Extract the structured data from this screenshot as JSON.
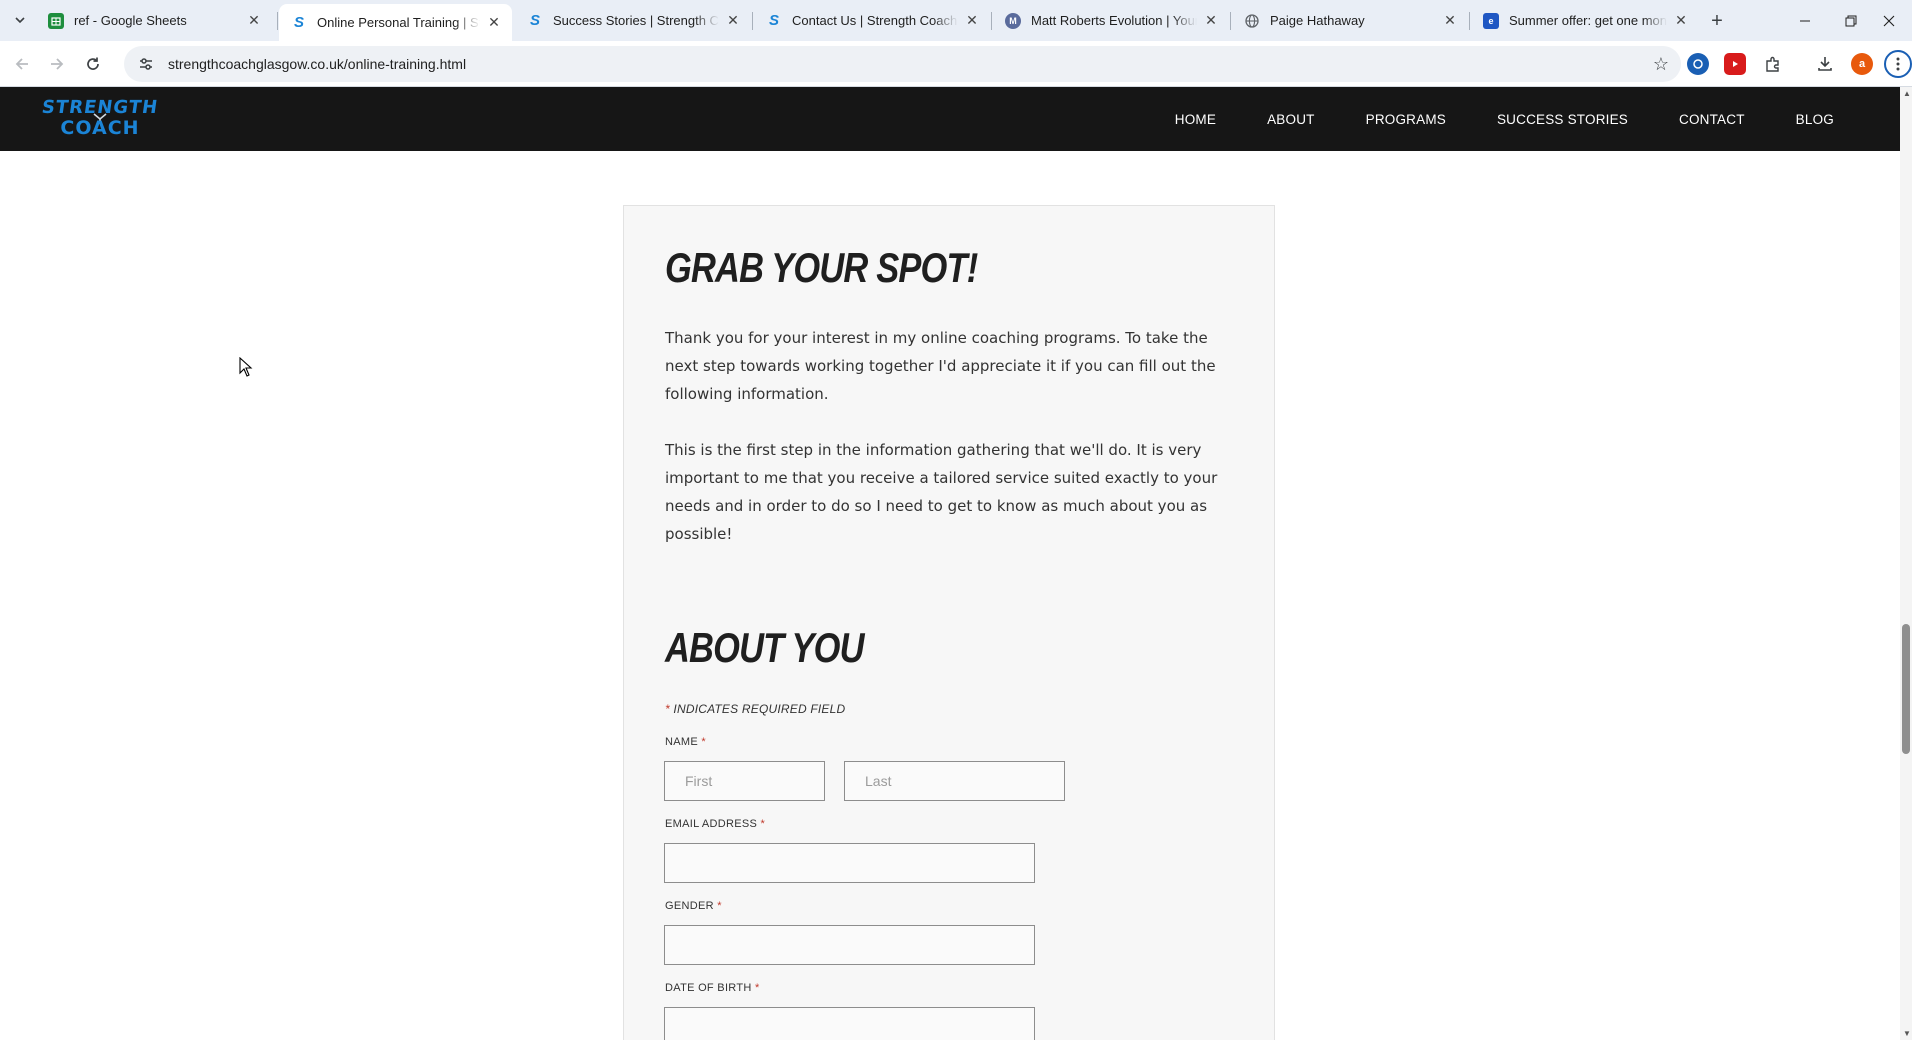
{
  "browser": {
    "tabs": [
      {
        "title": "ref - Google Sheets",
        "favicon": "sheets-icon",
        "active": false
      },
      {
        "title": "Online Personal Training | Strength Coach Glasgow",
        "favicon": "strength-coach-icon",
        "active": true
      },
      {
        "title": "Success Stories | Strength Coach Glasgow",
        "favicon": "strength-coach-icon",
        "active": false
      },
      {
        "title": "Contact Us | Strength Coach Glasgow",
        "favicon": "strength-coach-icon",
        "active": false
      },
      {
        "title": "Matt Roberts Evolution | Young",
        "favicon": "matt-roberts-icon",
        "active": false
      },
      {
        "title": "Paige Hathaway",
        "favicon": "globe-icon",
        "active": false
      },
      {
        "title": "Summer offer: get one month free",
        "favicon": "offer-icon",
        "active": false
      }
    ],
    "url": "strengthcoachglasgow.co.uk/online-training.html",
    "profile_initial": "a"
  },
  "site": {
    "logo": {
      "top": "STRENGTH",
      "bottom": "COACH"
    },
    "nav": [
      "HOME",
      "ABOUT",
      "PROGRAMS",
      "SUCCESS STORIES",
      "CONTACT",
      "BLOG"
    ]
  },
  "content": {
    "heading1": "GRAB YOUR SPOT!",
    "para1": "Thank you for your interest in my online coaching programs. To take the next step towards working together I'd appreciate it if you can fill out the following information.",
    "para2": "This is the first step in the information gathering that we'll do. It is very important to me that you receive a tailored service suited exactly to your needs and in order to do so I need to get to know as much about you as possible!",
    "heading2": "ABOUT YOU",
    "required_note": "INDICATES REQUIRED FIELD",
    "required_star": "*"
  },
  "form": {
    "name_label": "NAME",
    "first_placeholder": "First",
    "last_placeholder": "Last",
    "email_label": "EMAIL ADDRESS",
    "gender_label": "GENDER",
    "dob_label": "DATE OF BIRTH"
  },
  "colors": {
    "brand_blue": "#1b84d6",
    "header_bg": "#161616",
    "required_red": "#c0392b"
  }
}
